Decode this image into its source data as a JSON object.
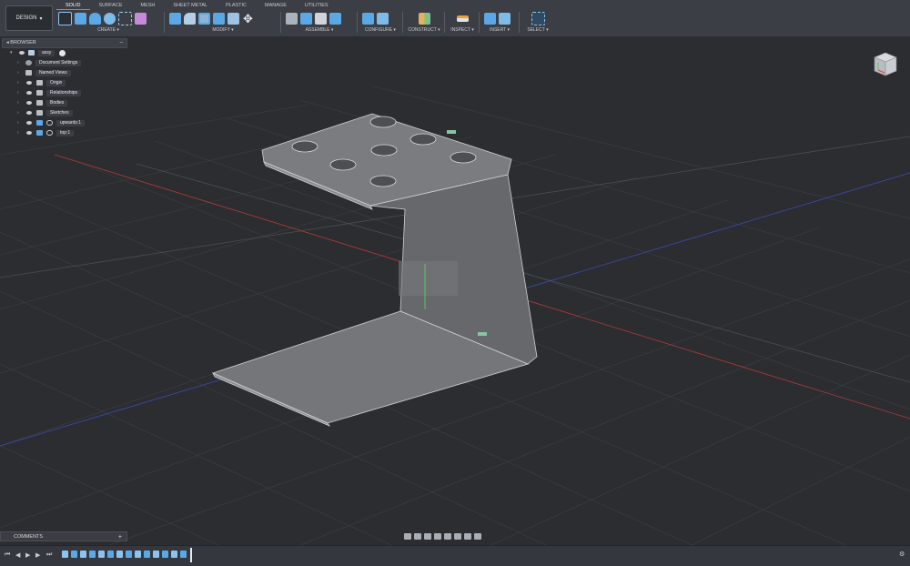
{
  "toolbar": {
    "workspace": "DESIGN",
    "tabs": [
      "SOLID",
      "SURFACE",
      "MESH",
      "SHEET METAL",
      "PLASTIC",
      "MANAGE",
      "UTILITIES"
    ],
    "active_tab": "SOLID",
    "groups": [
      {
        "label": "CREATE ▾",
        "icons": [
          "new-sketch-icon",
          "extrude-icon",
          "revolve-icon",
          "hole-icon",
          "rectangle-icon",
          "form-icon"
        ]
      },
      {
        "label": "MODIFY ▾",
        "icons": [
          "press-pull-icon",
          "fillet-icon",
          "shell-icon",
          "combine-icon",
          "align-icon",
          "move-icon"
        ]
      },
      {
        "label": "ASSEMBLE ▾",
        "icons": [
          "new-component-icon",
          "joint-icon",
          "as-built-joint-icon",
          "joint-origin-icon"
        ]
      },
      {
        "label": "CONFIGURE ▾",
        "icons": [
          "configure-icon",
          "table-icon"
        ]
      },
      {
        "label": "CONSTRUCT ▾",
        "icons": [
          "offset-plane-icon"
        ]
      },
      {
        "label": "INSPECT ▾",
        "icons": [
          "measure-icon"
        ]
      },
      {
        "label": "INSERT ▾",
        "icons": [
          "insert-derive-icon",
          "insert-image-icon"
        ]
      },
      {
        "label": "SELECT ▾",
        "icons": [
          "select-icon"
        ]
      }
    ]
  },
  "browser": {
    "title": "BROWSER",
    "collapse": "–",
    "root": "assy",
    "items": [
      {
        "label": "Document Settings",
        "icon": "gear-icon",
        "eye": false
      },
      {
        "label": "Named Views",
        "icon": "folder-icon",
        "eye": false
      },
      {
        "label": "Origin",
        "icon": "folder-icon",
        "eye": true
      },
      {
        "label": "Relationships",
        "icon": "folder-icon",
        "eye": true
      },
      {
        "label": "Bodies",
        "icon": "folder-icon",
        "eye": true
      },
      {
        "label": "Sketches",
        "icon": "folder-icon",
        "eye": true
      },
      {
        "label": "upwards:1",
        "icon": "component-icon",
        "eye": true
      },
      {
        "label": "top:1",
        "icon": "component-icon",
        "eye": true
      }
    ]
  },
  "comments": {
    "title": "COMMENTS",
    "add": "+"
  },
  "colors": {
    "accent": "#4b9fe8",
    "toolbar_bg": "#3b3f45",
    "viewport_bg": "#2b2d31",
    "model_fill": "#6f7174",
    "axis_red": "#b23a3a",
    "axis_blue": "#3a4cb2"
  },
  "timeline": {
    "controls": [
      "skip-to-start-icon",
      "step-back-icon",
      "play-icon",
      "step-forward-icon",
      "skip-to-end-icon"
    ],
    "features_count": 14
  },
  "navbar": {
    "icons": [
      "orbit-icon",
      "look-at-icon",
      "pan-icon",
      "zoom-icon",
      "fit-icon",
      "display-settings-icon",
      "grid-settings-icon",
      "viewports-icon"
    ]
  }
}
